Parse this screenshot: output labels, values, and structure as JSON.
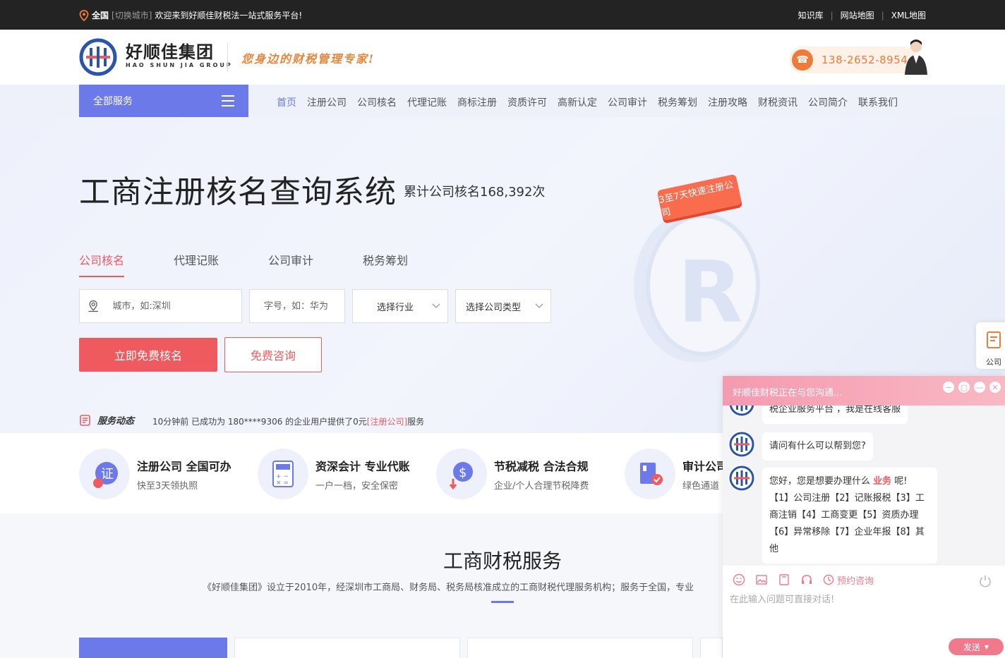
{
  "topbar": {
    "city": "全国",
    "switch_city": "[切换城市]",
    "welcome": "欢迎来到好顺佳财税法一站式服务平台!",
    "links": [
      "知识库",
      "网站地图",
      "XML地图"
    ]
  },
  "header": {
    "brand_cn": "好顺佳集团",
    "brand_en": "HAO SHUN JIA GROUP",
    "slogan": "您身边的财税管理专家!",
    "phone": "138-2652-8954"
  },
  "nav": {
    "all_services": "全部服务",
    "items": [
      "首页",
      "注册公司",
      "公司核名",
      "代理记账",
      "商标注册",
      "资质许可",
      "高新认定",
      "公司审计",
      "税务筹划",
      "注册攻略",
      "财税资讯",
      "公司简介",
      "联系我们"
    ]
  },
  "hero": {
    "title": "工商注册核名查询系统",
    "subtitle": "累计公司核名168,392次",
    "badge": "3至7天快速注册公司",
    "tabs": [
      "公司核名",
      "代理记账",
      "公司审计",
      "税务筹划"
    ],
    "city_placeholder": "城市，如:深圳",
    "name_placeholder": "字号，如：华为",
    "industry_select": "选择行业",
    "type_select": "选择公司类型",
    "primary_btn": "立即免费核名",
    "outline_btn": "免费咨询",
    "news_label": "服务动态",
    "news_line_prefix": "10分钟前 已成功为 180****9306 的企业用户提供了0元",
    "news_line_highlight": "[注册公司]",
    "news_line_suffix": "服务"
  },
  "features": [
    {
      "title": "注册公司 全国可办",
      "desc": "快至3天领执照",
      "icon": "certificate-icon"
    },
    {
      "title": "资深会计 专业代账",
      "desc": "一户一档，安全保密",
      "icon": "calculator-icon"
    },
    {
      "title": "节税减税 合法合规",
      "desc": "企业/个人合理节税降费",
      "icon": "dollar-icon"
    },
    {
      "title": "审计公司",
      "desc": "绿色通道",
      "icon": "audit-icon"
    }
  ],
  "services": {
    "title": "工商财税服务",
    "desc": "《好顺佳集团》设立于2010年，经深圳市工商局、财务局、税务局核准成立的工商财税代理服务机构；服务于全国，专业"
  },
  "float_side": {
    "label": "公司"
  },
  "chat": {
    "title": "好顺佳财税正在与您沟通...",
    "msg1": "税企业服务平台  ，我是在线客服",
    "msg2": "请问有什么可以帮到您?",
    "msg3_prefix": "您好，您是想要办理什么 ",
    "msg3_highlight": "业务",
    "msg3_suffix": " 呢!",
    "msg3_options": "【1】公司注册【2】记账报税【3】工商注销【4】工商变更【5】资质办理【6】异常移除【7】企业年报【8】其他",
    "appointment": "预约咨询",
    "input_placeholder": "在此输入问题可直接对话!",
    "send": "发送"
  },
  "colors": {
    "accent": "#6b7ae8",
    "primary_red": "#ef5a5f",
    "orange": "#f07a3a",
    "chat_pink": "#f59ab0"
  }
}
